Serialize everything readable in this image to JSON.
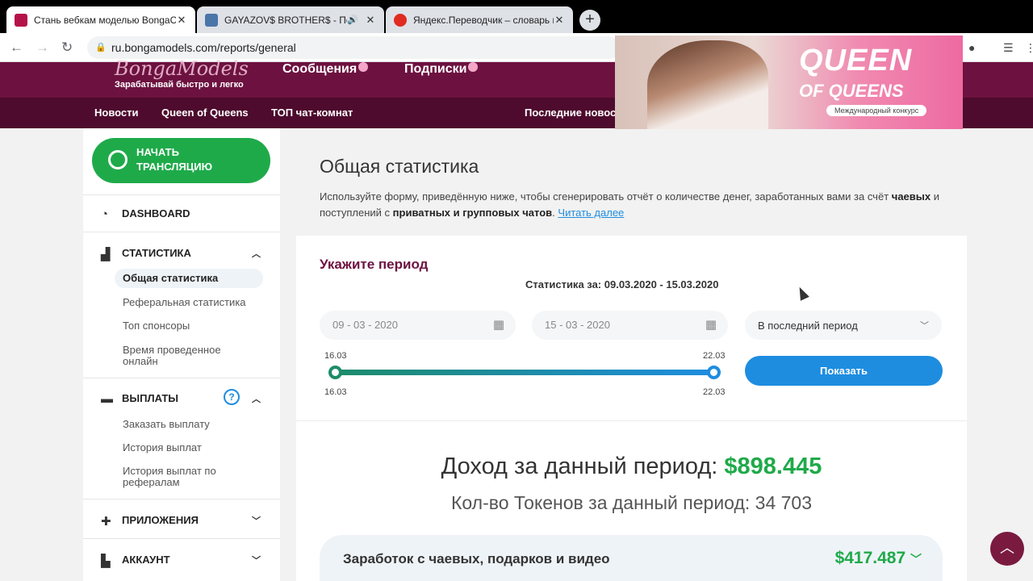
{
  "browser": {
    "tabs": [
      {
        "title": "Стань вебкам моделью BongaC",
        "favicon_color": "#b5124a"
      },
      {
        "title": "GAYAZOV$ BROTHER$ - По",
        "favicon_color": "#4a76a8"
      },
      {
        "title": "Яндекс.Переводчик – словарь и",
        "favicon_color": "#e02b20"
      }
    ],
    "url": "ru.bongamodels.com/reports/general"
  },
  "header": {
    "logo": "BongaModels",
    "slogan": "Зарабатывай быстро и легко",
    "nav": [
      "Сообщения",
      "Подписки"
    ],
    "subnav": [
      "Новости",
      "Queen of Queens",
      "ТОП чат-комнат",
      "Последние новос"
    ]
  },
  "banner": {
    "line1": "QUEEN",
    "line2": "OF QUEENS",
    "tag": "Международный конкурс"
  },
  "sidebar": {
    "start_button": "НАЧАТЬ ТРАНСЛЯЦИЮ",
    "dashboard": "DASHBOARD",
    "stats": {
      "title": "СТАТИСТИКА",
      "items": [
        "Общая статистика",
        "Реферальная статистика",
        "Топ спонсоры",
        "Время проведенное онлайн"
      ]
    },
    "payouts": {
      "title": "ВЫПЛАТЫ",
      "help": "?",
      "items": [
        "Заказать выплату",
        "История выплат",
        "История выплат по рефералам"
      ]
    },
    "apps": "ПРИЛОЖЕНИЯ",
    "account": "АККАУНТ"
  },
  "main": {
    "title": "Общая статистика",
    "desc_1": "Используйте форму, приведённую ниже, чтобы сгенерировать отчёт о количестве денег, заработанных вами за счёт ",
    "desc_b1": "чаевых",
    "desc_2": " и поступлений с ",
    "desc_b2": "приватных и групповых чатов",
    "desc_3": ". ",
    "read_more": "Читать далее",
    "period_heading": "Укажите период",
    "period_summary": "Статистика за: 09.03.2020 - 15.03.2020",
    "date_from": "09 - 03 - 2020",
    "date_to": "15 - 03 - 2020",
    "period_select": "В последний период",
    "slider": {
      "top_left": "16.03",
      "top_right": "22.03",
      "bottom_left": "16.03",
      "bottom_right": "22.03"
    },
    "show_button": "Показать",
    "income_label": "Доход за данный период: ",
    "income_value": "$898.445",
    "tokens": "Кол-во Токенов за данный период: 34 703",
    "earn_label": "Заработок с чаевых, подарков и видео",
    "earn_value": "$417.487"
  },
  "colors": {
    "brand": "#6d1240",
    "green": "#1faa4a",
    "blue": "#1e8de0"
  }
}
